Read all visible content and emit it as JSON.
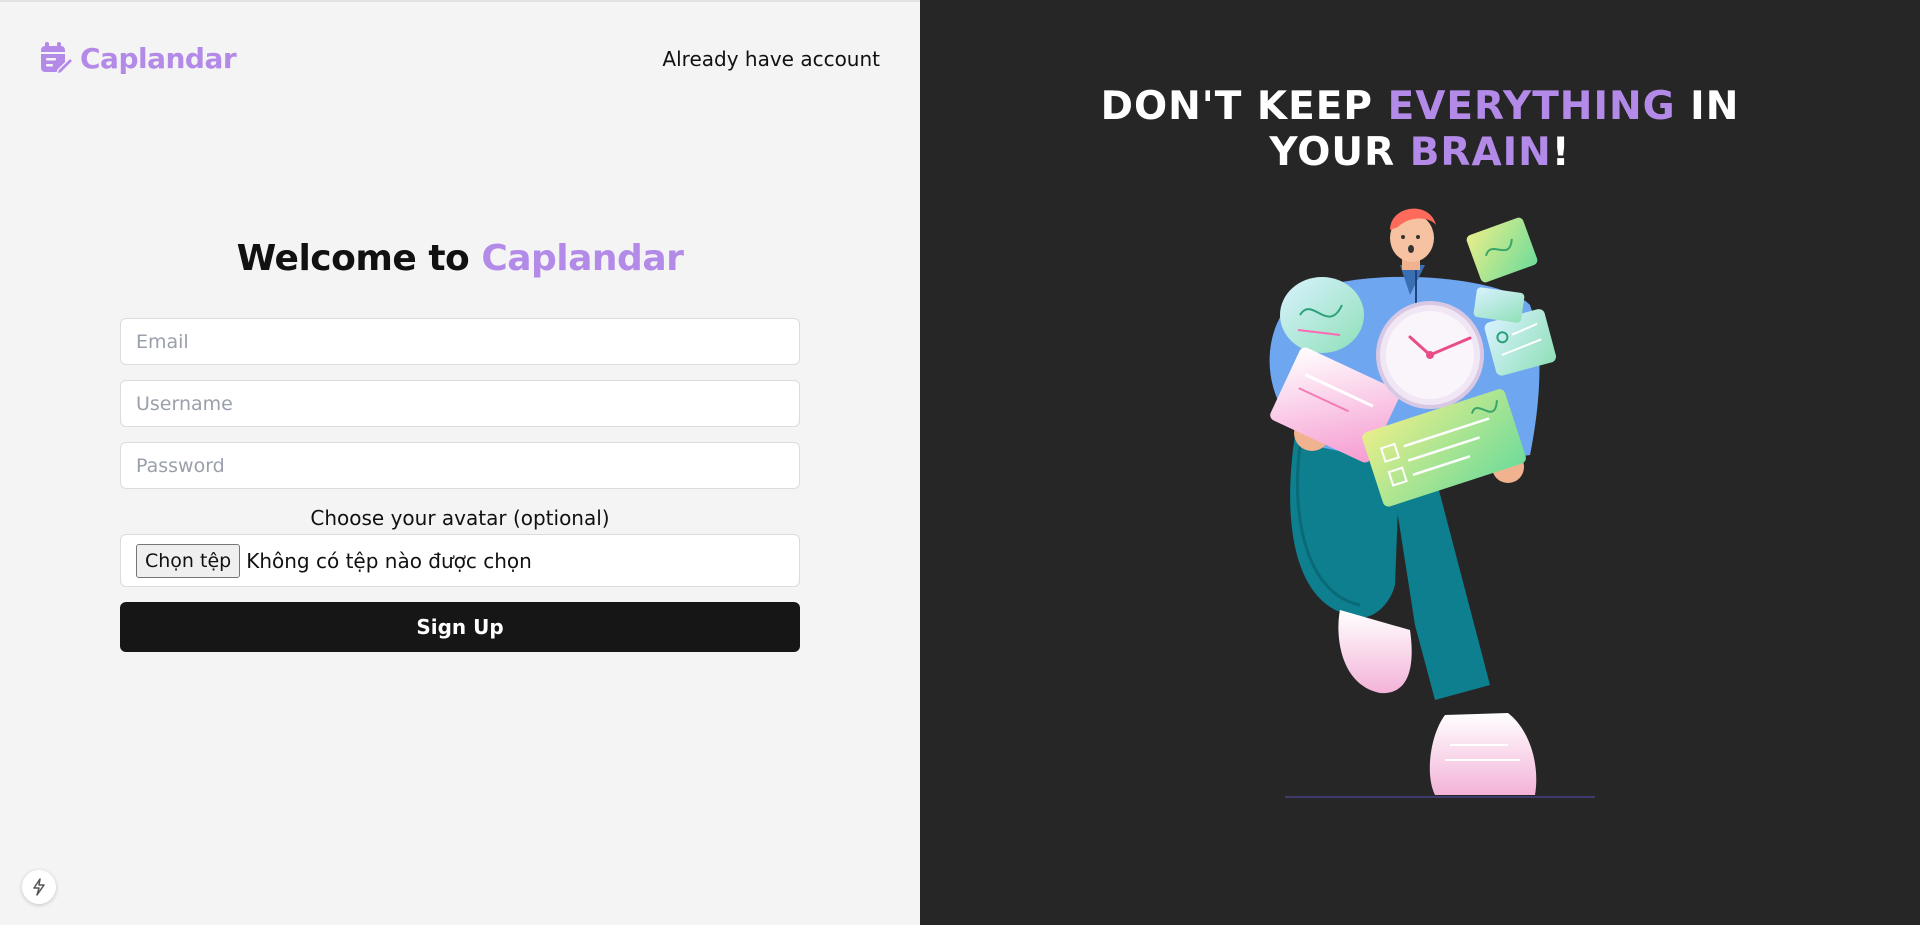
{
  "brand": {
    "name": "Caplandar",
    "accent_color": "#b38ae8",
    "icon": "calendar-edit-icon"
  },
  "header": {
    "login_link": "Already have account"
  },
  "form": {
    "title_prefix": "Welcome to ",
    "title_brand": "Caplandar",
    "email_placeholder": "Email",
    "username_placeholder": "Username",
    "password_placeholder": "Password",
    "avatar_label": "Choose your avatar (optional)",
    "file_button": "Chọn tệp",
    "file_status": "Không có tệp nào được chọn",
    "submit_label": "Sign Up"
  },
  "hero": {
    "line1_a": "DON'T KEEP ",
    "line1_b": "EVERYTHING",
    "line1_c": " IN",
    "line2_a": "YOUR ",
    "line2_b": "BRAIN",
    "line2_c": "!"
  },
  "widgets": {
    "corner_icon": "lightning-icon"
  }
}
